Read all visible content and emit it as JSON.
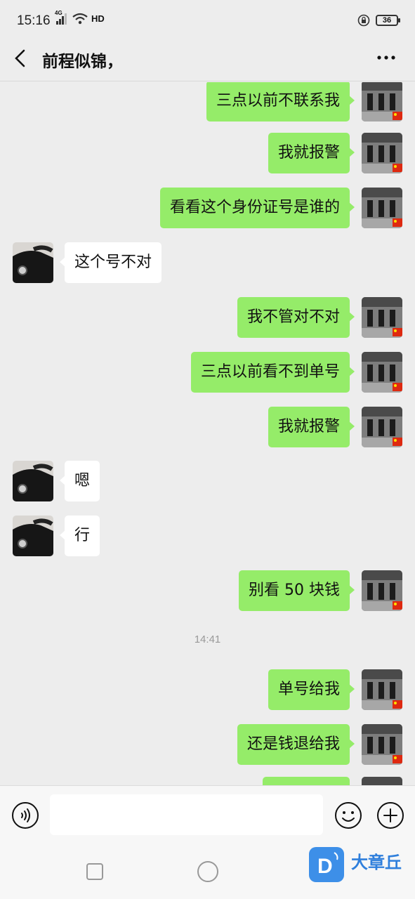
{
  "status_bar": {
    "time": "15:16",
    "network_label": "4G",
    "hd_label": "HD",
    "battery": "36"
  },
  "header": {
    "title": "前程似锦，"
  },
  "messages": [
    {
      "type": "text",
      "from": "me",
      "text": "三点以前不联系我"
    },
    {
      "type": "text",
      "from": "me",
      "text": "我就报警"
    },
    {
      "type": "text",
      "from": "me",
      "text": "看看这个身份证号是谁的"
    },
    {
      "type": "text",
      "from": "other",
      "text": "这个号不对"
    },
    {
      "type": "text",
      "from": "me",
      "text": "我不管对不对"
    },
    {
      "type": "text",
      "from": "me",
      "text": "三点以前看不到单号"
    },
    {
      "type": "text",
      "from": "me",
      "text": "我就报警"
    },
    {
      "type": "text",
      "from": "other",
      "text": "嗯"
    },
    {
      "type": "text",
      "from": "other",
      "text": "行"
    },
    {
      "type": "text",
      "from": "me",
      "text": "别看 50 块钱"
    },
    {
      "type": "time",
      "text": "14:41"
    },
    {
      "type": "text",
      "from": "me",
      "text": "单号给我"
    },
    {
      "type": "text",
      "from": "me",
      "text": "还是钱退给我"
    },
    {
      "type": "text",
      "from": "me",
      "text": ""
    }
  ],
  "input_bar": {
    "value": "",
    "voice_icon": "voice-icon",
    "emoji_icon": "emoji-icon",
    "plus_icon": "plus-icon"
  },
  "watermark": {
    "logo_letter": "D",
    "text": "大章丘"
  },
  "colors": {
    "bubble_me": "#95ec69",
    "bubble_other": "#ffffff",
    "background": "#ededed"
  }
}
